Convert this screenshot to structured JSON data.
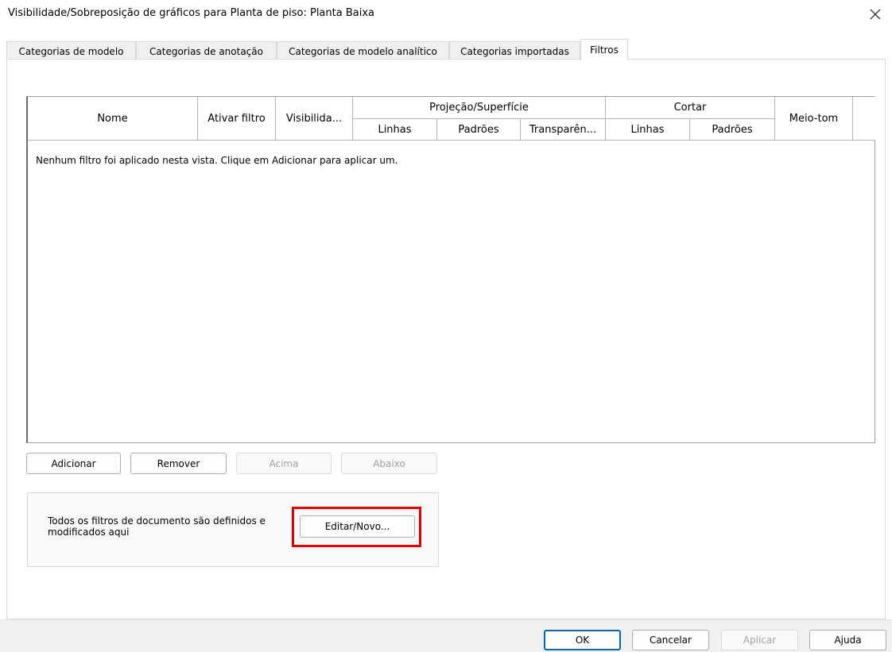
{
  "window": {
    "title": "Visibilidade/Sobreposição de gráficos para Planta de piso: Planta Baixa",
    "close_icon": "close-icon"
  },
  "tabs": [
    {
      "label": "Categorias de modelo",
      "active": false
    },
    {
      "label": "Categorias de anotação",
      "active": false
    },
    {
      "label": "Categorias de modelo analítico",
      "active": false
    },
    {
      "label": "Categorias importadas",
      "active": false
    },
    {
      "label": "Filtros",
      "active": true
    }
  ],
  "table": {
    "headers": {
      "nome": "Nome",
      "ativar": "Ativar filtro",
      "visibilidade": "Visibilida...",
      "projecao": "Projeção/Superfície",
      "proj_linhas": "Linhas",
      "proj_padroes": "Padrões",
      "proj_transparencia": "Transparên...",
      "cortar": "Cortar",
      "cortar_linhas": "Linhas",
      "cortar_padroes": "Padrões",
      "meio_tom": "Meio-tom"
    },
    "empty_message": "Nenhum filtro foi aplicado nesta vista. Clique em Adicionar para aplicar um."
  },
  "row_buttons": {
    "adicionar": "Adicionar",
    "remover": "Remover",
    "acima": "Acima",
    "abaixo": "Abaixo"
  },
  "filters_group": {
    "text": "Todos os filtros de documento são definidos e modificados aqui",
    "edit_button": "Editar/Novo...",
    "highlight_color": "#e00000"
  },
  "footer": {
    "ok": "OK",
    "cancelar": "Cancelar",
    "aplicar": "Aplicar",
    "ajuda": "Ajuda"
  }
}
